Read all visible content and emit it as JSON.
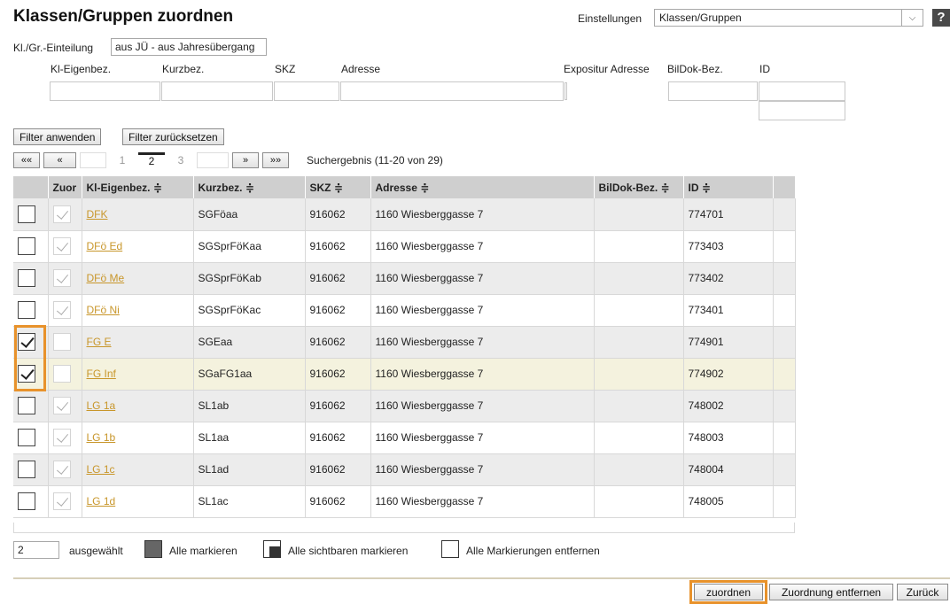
{
  "page": {
    "title": "Klassen/Gruppen zuordnen",
    "settings_label": "Einstellungen",
    "settings_value": "Klassen/Gruppen",
    "help": "?"
  },
  "filter": {
    "einteilung_label": "Kl./Gr.-Einteilung",
    "einteilung_value": "aus JÜ - aus Jahresübergang",
    "labels": {
      "kl_eigenbez": "Kl-Eigenbez.",
      "kurzbez": "Kurzbez.",
      "skz": "SKZ",
      "adresse": "Adresse",
      "expositur": "Expositur Adresse",
      "bildok": "BilDok-Bez.",
      "id": "ID"
    },
    "apply_label": "Filter anwenden",
    "reset_label": "Filter zurücksetzen"
  },
  "pager": {
    "first": "««",
    "prev": "«",
    "pages": [
      "1",
      "2",
      "3"
    ],
    "next": "»",
    "last": "»»",
    "result": "Suchergebnis (11-20 von 29)"
  },
  "table": {
    "headers": [
      "Zuor",
      "Kl-Eigenbez. ≑",
      "Kurzbez. ≑",
      "SKZ ≑",
      "Adresse ≑",
      "BilDok-Bez. ≑",
      "ID ≑"
    ],
    "rows": [
      {
        "sel": false,
        "zuor": true,
        "name": "DFK",
        "kurz": "SGFöaa",
        "skz": "916062",
        "adresse": "1160 Wiesberggasse 7",
        "bildok": "",
        "id": "774701"
      },
      {
        "sel": false,
        "zuor": true,
        "name": "DFö Ed",
        "kurz": "SGSprFöKaa",
        "skz": "916062",
        "adresse": "1160 Wiesberggasse 7",
        "bildok": "",
        "id": "773403"
      },
      {
        "sel": false,
        "zuor": true,
        "name": "DFö Me",
        "kurz": "SGSprFöKab",
        "skz": "916062",
        "adresse": "1160 Wiesberggasse 7",
        "bildok": "",
        "id": "773402"
      },
      {
        "sel": false,
        "zuor": true,
        "name": "DFö Ni",
        "kurz": "SGSprFöKac",
        "skz": "916062",
        "adresse": "1160 Wiesberggasse 7",
        "bildok": "",
        "id": "773401"
      },
      {
        "sel": true,
        "zuor": false,
        "name": "FG E",
        "kurz": "SGEaa",
        "skz": "916062",
        "adresse": "1160 Wiesberggasse 7",
        "bildok": "",
        "id": "774901"
      },
      {
        "sel": true,
        "zuor": false,
        "name": "FG Inf",
        "kurz": "SGaFG1aa",
        "skz": "916062",
        "adresse": "1160 Wiesberggasse 7",
        "bildok": "",
        "id": "774902"
      },
      {
        "sel": false,
        "zuor": true,
        "name": "LG 1a",
        "kurz": "SL1ab",
        "skz": "916062",
        "adresse": "1160 Wiesberggasse 7",
        "bildok": "",
        "id": "748002"
      },
      {
        "sel": false,
        "zuor": true,
        "name": "LG 1b",
        "kurz": "SL1aa",
        "skz": "916062",
        "adresse": "1160 Wiesberggasse 7",
        "bildok": "",
        "id": "748003"
      },
      {
        "sel": false,
        "zuor": true,
        "name": "LG 1c",
        "kurz": "SL1ad",
        "skz": "916062",
        "adresse": "1160 Wiesberggasse 7",
        "bildok": "",
        "id": "748004"
      },
      {
        "sel": false,
        "zuor": true,
        "name": "LG 1d",
        "kurz": "SL1ac",
        "skz": "916062",
        "adresse": "1160 Wiesberggasse 7",
        "bildok": "",
        "id": "748005"
      }
    ]
  },
  "selection": {
    "count": "2",
    "label": "ausgewählt",
    "mark_all": "Alle markieren",
    "mark_visible": "Alle sichtbaren markieren",
    "unmark_all": "Alle Markierungen entfernen"
  },
  "actions": {
    "assign": "zuordnen",
    "remove": "Zuordnung entfernen",
    "back": "Zurück"
  },
  "colors": {
    "highlight": "#e8922b",
    "link": "#c8962a"
  }
}
